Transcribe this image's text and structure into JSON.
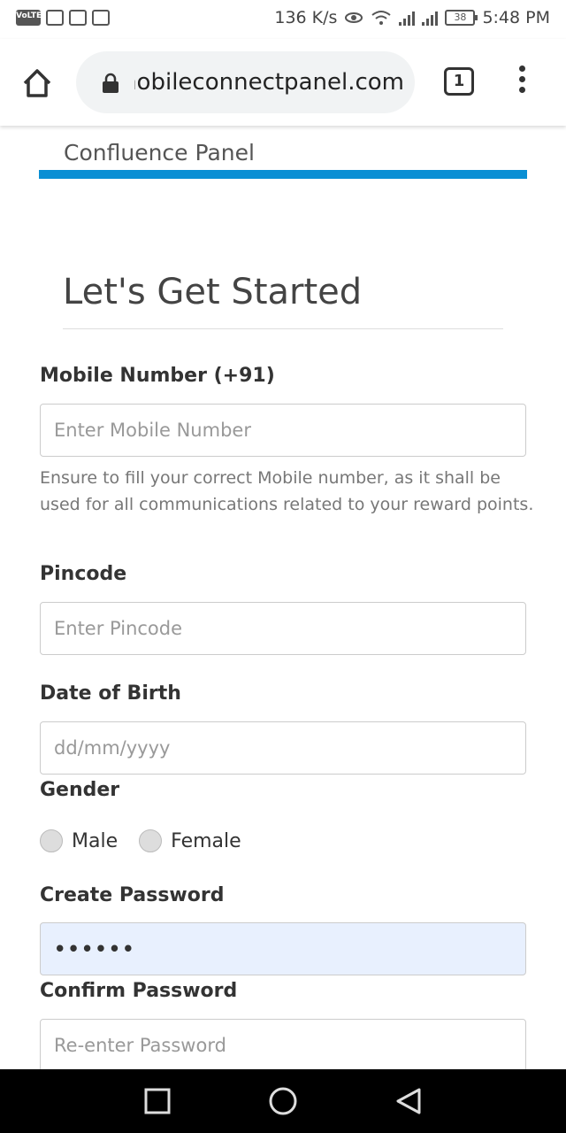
{
  "status_bar": {
    "left_icons": [
      "volte-icon",
      "activity-icon",
      "news-icon",
      "mail-icon"
    ],
    "volte_label": "VoLTE",
    "speed": "136 K/s",
    "battery": "38",
    "time": "5:48 PM"
  },
  "browser": {
    "url": "mobileconnectpanel.com",
    "tab_count": "1"
  },
  "page": {
    "brand": "Confluence Panel",
    "heading": "Let's Get Started",
    "mobile": {
      "label": "Mobile Number (+91)",
      "placeholder": "Enter Mobile Number",
      "help": "Ensure to fill your correct Mobile number, as it shall be used for all communications related to your reward points."
    },
    "pincode": {
      "label": "Pincode",
      "placeholder": "Enter Pincode"
    },
    "dob": {
      "label": "Date of Birth",
      "placeholder": "dd/mm/yyyy"
    },
    "gender": {
      "label": "Gender",
      "options": [
        "Male",
        "Female"
      ]
    },
    "password": {
      "label": "Create Password",
      "value": "••••••"
    },
    "confirm_password": {
      "label": "Confirm Password",
      "placeholder": "Re-enter Password"
    }
  },
  "colors": {
    "accent": "#0a8fd4",
    "autofill": "#e8f0fe"
  }
}
